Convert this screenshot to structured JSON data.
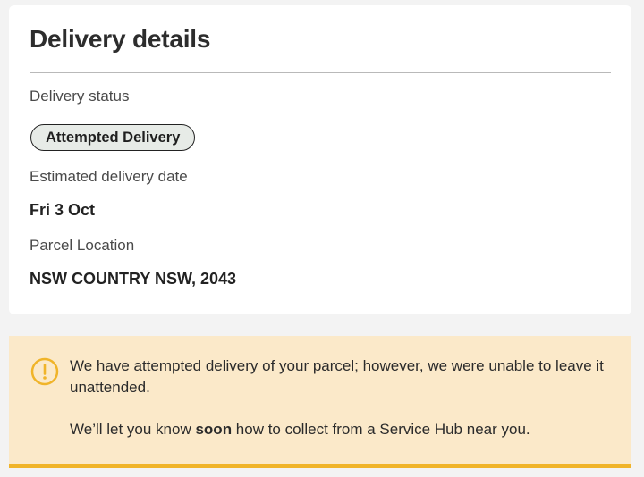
{
  "card": {
    "title": "Delivery details",
    "status_label": "Delivery status",
    "status_value": "Attempted Delivery",
    "eta_label": "Estimated delivery date",
    "eta_value": "Fri 3 Oct",
    "location_label": "Parcel Location",
    "location_value": "NSW COUNTRY NSW, 2043"
  },
  "notice": {
    "icon": "warning-circle-icon",
    "paragraph1": "We have attempted delivery of your parcel; however, we were unable to leave it unattended.",
    "paragraph2_before": "We’ll let you know ",
    "paragraph2_bold": "soon",
    "paragraph2_after": " how to collect from a Service Hub near you."
  },
  "colors": {
    "notice_background": "#fbe9c9",
    "notice_accent": "#f0b429",
    "status_pill_background": "#e7ebe7"
  }
}
